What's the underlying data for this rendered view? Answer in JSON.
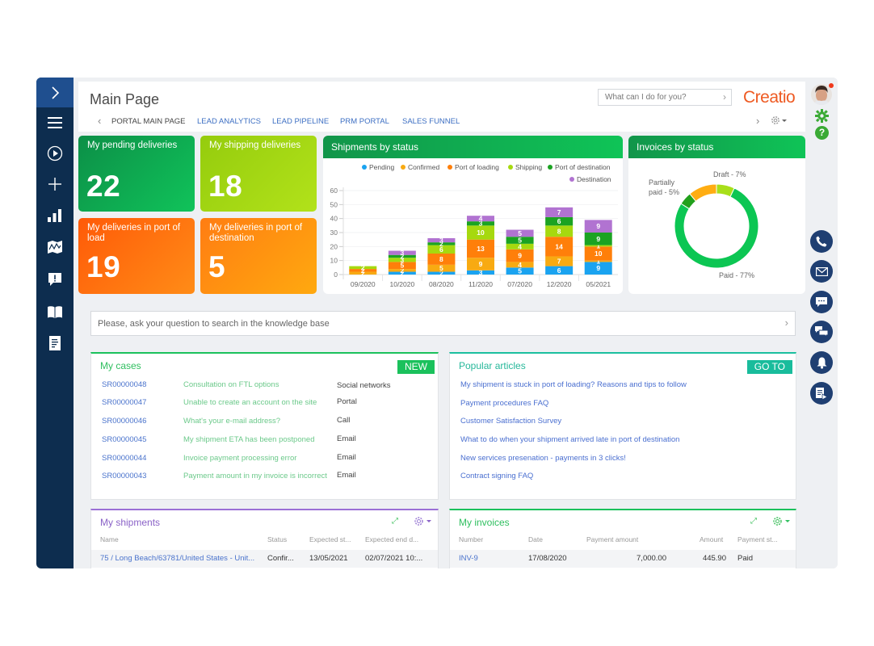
{
  "app": {
    "title": "Main Page",
    "brand": "Creatio",
    "command_placeholder": "What can I do for you?",
    "colors": {
      "brand": "#ee5a22",
      "sidebar": "#0d2d4f",
      "sidebar_top": "#1f4f8f",
      "accent_green": "#1bc15c",
      "accent_teal": "#19bc9c",
      "link": "#4a73cc"
    }
  },
  "sidebar": {
    "items": [
      {
        "icon": "chevron-right-icon"
      },
      {
        "icon": "menu-icon"
      },
      {
        "icon": "play-circle-icon"
      },
      {
        "icon": "plus-icon"
      },
      {
        "icon": "bar-chart-icon"
      },
      {
        "icon": "map-icon"
      },
      {
        "icon": "alert-message-icon"
      },
      {
        "icon": "book-icon"
      },
      {
        "icon": "document-icon"
      }
    ]
  },
  "right_rail": {
    "items": [
      {
        "icon": "avatar",
        "notification": true
      },
      {
        "icon": "gear-icon"
      },
      {
        "icon": "help-icon"
      },
      {
        "icon": "phone-icon"
      },
      {
        "icon": "email-icon"
      },
      {
        "icon": "chat-icon"
      },
      {
        "icon": "chats-icon"
      },
      {
        "icon": "bell-icon"
      },
      {
        "icon": "document-play-icon"
      }
    ]
  },
  "tabs": [
    {
      "label": "PORTAL MAIN PAGE",
      "active": true
    },
    {
      "label": "LEAD ANALYTICS",
      "active": false
    },
    {
      "label": "LEAD PIPELINE",
      "active": false
    },
    {
      "label": "PRM PORTAL",
      "active": false
    },
    {
      "label": "SALES FUNNEL",
      "active": false
    }
  ],
  "tiles": [
    {
      "title": "My pending deliveries",
      "value": "22"
    },
    {
      "title": "My shipping deliveries",
      "value": "18"
    },
    {
      "title": "My deliveries in port of load",
      "value": "19"
    },
    {
      "title": "My deliveries in port of destination",
      "value": "5"
    }
  ],
  "chart_data": [
    {
      "type": "bar",
      "stacked": true,
      "title": "Shipments by status",
      "xlabel": "",
      "ylabel": "",
      "ylim": [
        0,
        60
      ],
      "yticks": [
        0,
        10,
        20,
        30,
        40,
        50,
        60
      ],
      "grid": true,
      "legend": "top-right",
      "categories": [
        "09/2020",
        "10/2020",
        "08/2020",
        "11/2020",
        "07/2020",
        "12/2020",
        "05/2021"
      ],
      "series": [
        {
          "name": "Pending",
          "color": "#1aa3f0",
          "values": [
            0,
            2,
            2,
            3,
            5,
            6,
            9
          ]
        },
        {
          "name": "Confirmed",
          "color": "#f8aa12",
          "values": [
            2,
            2,
            5,
            9,
            4,
            7,
            1
          ]
        },
        {
          "name": "Port of loading",
          "color": "#ff7f0a",
          "values": [
            2,
            5,
            8,
            13,
            9,
            14,
            10
          ]
        },
        {
          "name": "Shipping",
          "color": "#a6d90f",
          "values": [
            2,
            3,
            6,
            10,
            4,
            8,
            1
          ]
        },
        {
          "name": "Port of destination",
          "color": "#1ba322",
          "values": [
            0,
            2,
            2,
            3,
            5,
            6,
            9
          ]
        },
        {
          "name": "Destination",
          "color": "#b173d1",
          "values": [
            0,
            3,
            3,
            4,
            5,
            7,
            9
          ]
        }
      ]
    },
    {
      "type": "pie",
      "donut": true,
      "title": "Invoices by status",
      "slices": [
        {
          "label": "Draft - 7%",
          "name": "Draft",
          "value": 7,
          "color": "#a8df1a"
        },
        {
          "label": "Paid - 77%",
          "name": "Paid",
          "value": 77,
          "color": "#0cc653"
        },
        {
          "label": "Partially paid - 5%",
          "name": "Partially paid",
          "value": 5,
          "color": "#22a01c"
        },
        {
          "label": "",
          "name": "",
          "value": 11,
          "color": "#ffad12"
        }
      ]
    }
  ],
  "kb_search": {
    "placeholder": "Please, ask your question to search in the knowledge base"
  },
  "cases": {
    "title": "My cases",
    "button": "NEW",
    "rows": [
      {
        "id": "SR00000048",
        "subject": "Consultation on FTL options",
        "channel": "Social networks"
      },
      {
        "id": "SR00000047",
        "subject": "Unable to create an account on the site",
        "channel": "Portal"
      },
      {
        "id": "SR00000046",
        "subject": "What's your e-mail address?",
        "channel": "Call"
      },
      {
        "id": "SR00000045",
        "subject": "My shipment ETA has been postponed",
        "channel": "Email"
      },
      {
        "id": "SR00000044",
        "subject": "Invoice payment processing error",
        "channel": "Email"
      },
      {
        "id": "SR00000043",
        "subject": "Payment amount in my invoice is incorrect",
        "channel": "Email"
      }
    ]
  },
  "articles": {
    "title": "Popular articles",
    "button": "GO TO",
    "items": [
      "My shipment is stuck in port of loading? Reasons and tips to follow",
      "Payment procedures FAQ",
      "Customer Satisfaction Survey",
      "What to do when your shipment arrived late in port of destination",
      "New services presenation - payments in 3 clicks!",
      "Contract signing FAQ"
    ]
  },
  "shipments": {
    "title": "My shipments",
    "columns": [
      "Name",
      "Status",
      "Expected st...",
      "Expected end d..."
    ],
    "rows": [
      {
        "name": "75 / Long Beach/63781/United States - Unit...",
        "status": "Confir...",
        "start": "13/05/2021",
        "end": "02/07/2021 10:..."
      }
    ]
  },
  "invoices": {
    "title": "My invoices",
    "columns": [
      "Number",
      "Date",
      "Payment amount",
      "Amount",
      "Payment st..."
    ],
    "rows": [
      {
        "number": "INV-9",
        "date": "17/08/2020",
        "payment_amount": "7,000.00",
        "amount": "445.90",
        "status": "Paid"
      }
    ]
  }
}
